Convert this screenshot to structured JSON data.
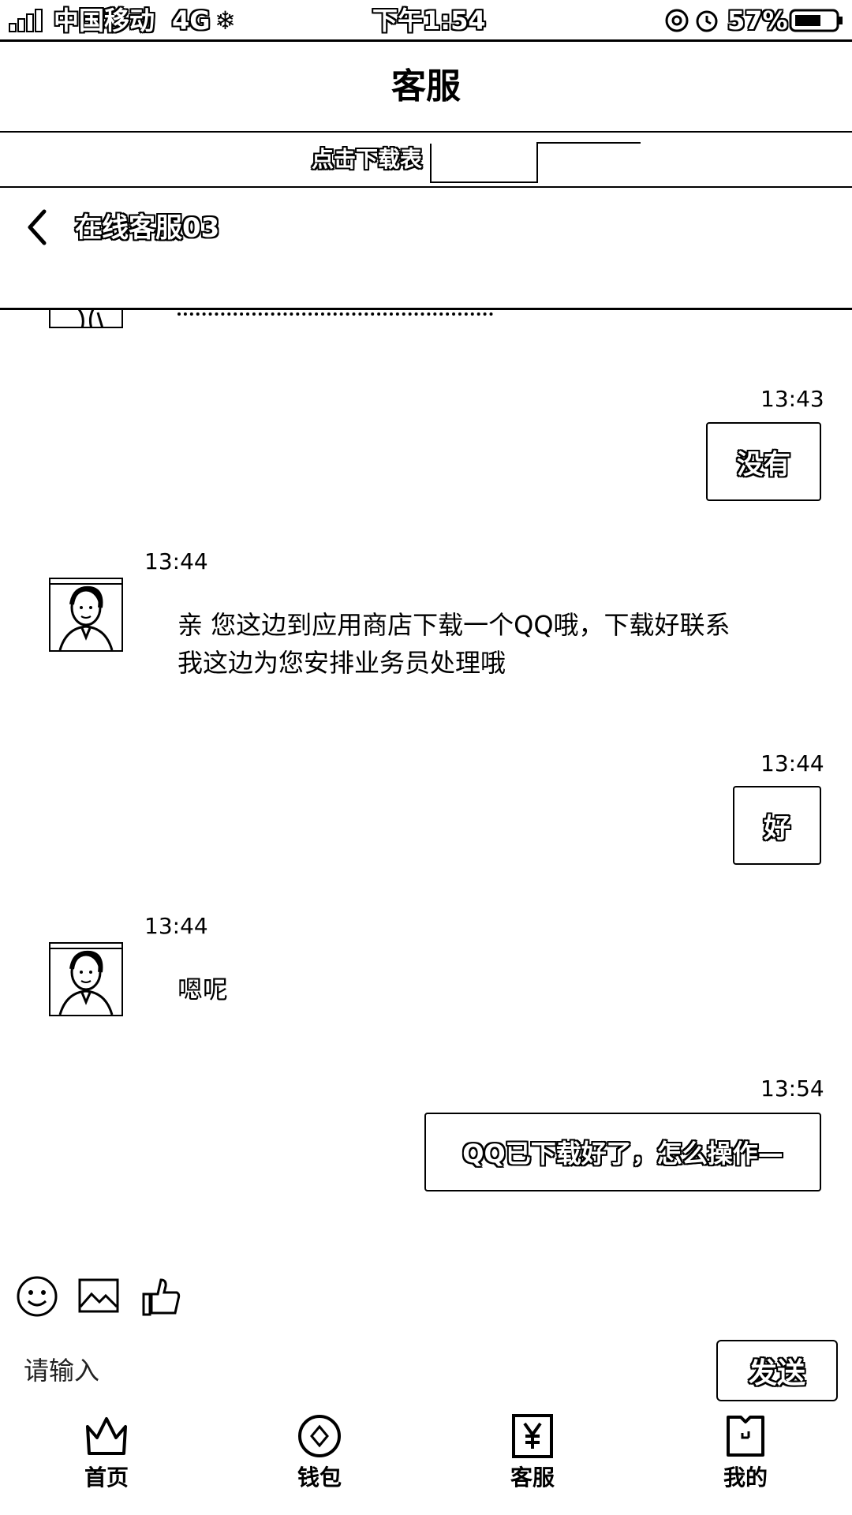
{
  "status_bar": {
    "carrier": "中国移动",
    "network": "4G",
    "time": "下午1:54",
    "battery": "57%"
  },
  "header": {
    "title": "客服"
  },
  "download_bar": {
    "text": "点击下载表"
  },
  "chat_header": {
    "agent_name": "在线客服03"
  },
  "messages": [
    {
      "sender": "user",
      "time": "13:43",
      "text": "没有"
    },
    {
      "sender": "agent",
      "time": "13:44",
      "lines": [
        "亲 您这边到应用商店下载一个QQ哦，下载好联系",
        "我这边为您安排业务员处理哦"
      ]
    },
    {
      "sender": "user",
      "time": "13:44",
      "text": "好"
    },
    {
      "sender": "agent",
      "time": "13:44",
      "lines": [
        "嗯呢"
      ]
    },
    {
      "sender": "user",
      "time": "13:54",
      "text": "QQ已下载好了，怎么操作—"
    }
  ],
  "input": {
    "placeholder": "请输入",
    "send_label": "发送"
  },
  "toolbar": {
    "icons": [
      "emoji-icon",
      "image-icon",
      "thumbs-up-icon"
    ]
  },
  "nav": {
    "items": [
      {
        "label": "首页",
        "icon": "crown-icon"
      },
      {
        "label": "钱包",
        "icon": "coin-icon"
      },
      {
        "label": "客服",
        "icon": "yen-icon"
      },
      {
        "label": "我的",
        "icon": "profile-icon"
      }
    ]
  }
}
